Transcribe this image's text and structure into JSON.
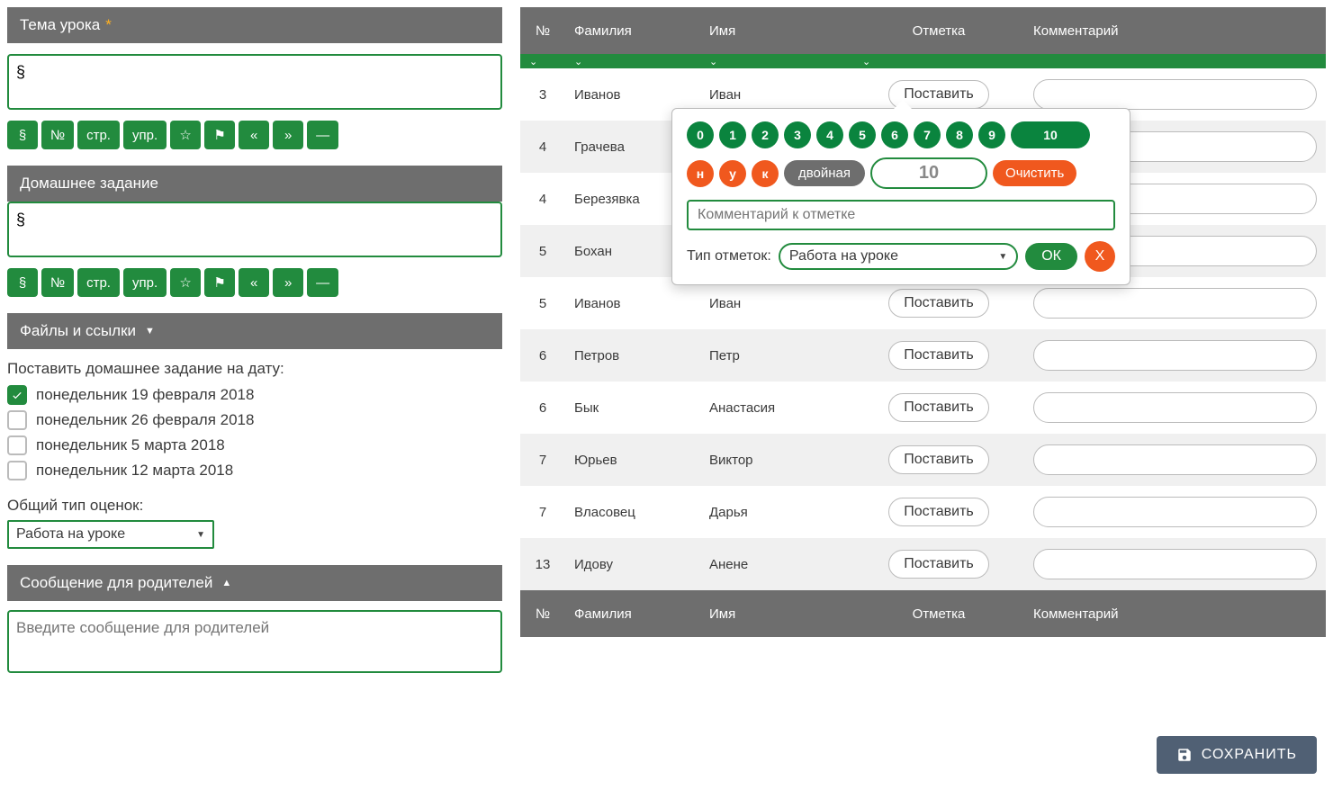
{
  "left": {
    "topic_header": "Тема урока",
    "topic_value": "§",
    "homework_header": "Домашнее задание",
    "homework_value": "§",
    "files_header": "Файлы и ссылки",
    "symbol_buttons": [
      "§",
      "№",
      "стр.",
      "упр.",
      "☆",
      "⚑",
      "«",
      "»",
      "—"
    ],
    "homework_date_title": "Поставить домашнее задание на дату:",
    "dates": [
      {
        "label": "понедельник 19 февраля 2018",
        "checked": true
      },
      {
        "label": "понедельник 26 февраля 2018",
        "checked": false
      },
      {
        "label": "понедельник 5 марта 2018",
        "checked": false
      },
      {
        "label": "понедельник 12 марта 2018",
        "checked": false
      }
    ],
    "grade_type_label": "Общий тип оценок:",
    "grade_type_value": "Работа на уроке",
    "parents_header": "Сообщение для родителей",
    "parents_placeholder": "Введите сообщение для родителей"
  },
  "table": {
    "headers": {
      "num": "№",
      "lastname": "Фамилия",
      "name": "Имя",
      "grade": "Отметка",
      "comment": "Комментарий"
    },
    "grade_button_label": "Поставить",
    "rows": [
      {
        "num": "3",
        "lastname": "Иванов",
        "name": "Иван",
        "alt": false
      },
      {
        "num": "4",
        "lastname": "Грачева",
        "name": "",
        "alt": true
      },
      {
        "num": "4",
        "lastname": "Березявка",
        "name": "",
        "alt": false
      },
      {
        "num": "5",
        "lastname": "Бохан",
        "name": "",
        "alt": true
      },
      {
        "num": "5",
        "lastname": "Иванов",
        "name": "Иван",
        "alt": false
      },
      {
        "num": "6",
        "lastname": "Петров",
        "name": "Петр",
        "alt": true
      },
      {
        "num": "6",
        "lastname": "Бык",
        "name": "Анастасия",
        "alt": false
      },
      {
        "num": "7",
        "lastname": "Юрьев",
        "name": "Виктор",
        "alt": true
      },
      {
        "num": "7",
        "lastname": "Власовец",
        "name": "Дарья",
        "alt": false
      },
      {
        "num": "13",
        "lastname": "Идову",
        "name": "Анене",
        "alt": true
      }
    ]
  },
  "popup": {
    "numbers": [
      "0",
      "1",
      "2",
      "3",
      "4",
      "5",
      "6",
      "7",
      "8",
      "9",
      "10"
    ],
    "letters": [
      "н",
      "у",
      "к"
    ],
    "double_label": "двойная",
    "current_value": "10",
    "clear_label": "Очистить",
    "comment_placeholder": "Комментарий к отметке",
    "type_label": "Тип отметок:",
    "type_value": "Работа на уроке",
    "ok_label": "ОК",
    "x_label": "X"
  },
  "save_label": "СОХРАНИТЬ"
}
